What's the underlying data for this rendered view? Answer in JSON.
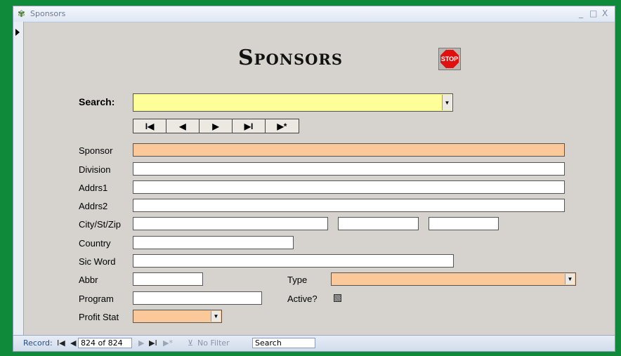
{
  "window": {
    "title": "Sponsors",
    "minimize": "_",
    "maximize": "□",
    "close": "X"
  },
  "heading": "Sponsors",
  "stop_button": {
    "label": "STOP"
  },
  "search": {
    "label": "Search:",
    "value": ""
  },
  "nav": {
    "first": "I◀",
    "prev": "◀",
    "next": "▶",
    "last": "▶I",
    "new": "▶*"
  },
  "fields": {
    "sponsor": {
      "label": "Sponsor",
      "value": ""
    },
    "division": {
      "label": "Division",
      "value": ""
    },
    "addrs1": {
      "label": "Addrs1",
      "value": ""
    },
    "addrs2": {
      "label": "Addrs2",
      "value": ""
    },
    "city_st_zip": {
      "label": "City/St/Zip",
      "city": "",
      "state": "",
      "zip": ""
    },
    "country": {
      "label": "Country",
      "value": ""
    },
    "sic_word": {
      "label": "Sic Word",
      "value": ""
    },
    "abbr": {
      "label": "Abbr",
      "value": ""
    },
    "type": {
      "label": "Type",
      "value": ""
    },
    "program": {
      "label": "Program",
      "value": ""
    },
    "active": {
      "label": "Active?",
      "checked": null
    },
    "profit_stat": {
      "label": "Profit Stat",
      "value": ""
    }
  },
  "statusbar": {
    "record_label": "Record:",
    "first": "I◀",
    "prev": "◀",
    "position": "824 of 824",
    "next": "▶",
    "last": "▶I",
    "new": "▶*",
    "filter": "No Filter",
    "search_placeholder": "Search"
  },
  "colors": {
    "search_bg": "#ffff99",
    "required_bg": "#fbc89a",
    "background": "#0f8a3a"
  }
}
